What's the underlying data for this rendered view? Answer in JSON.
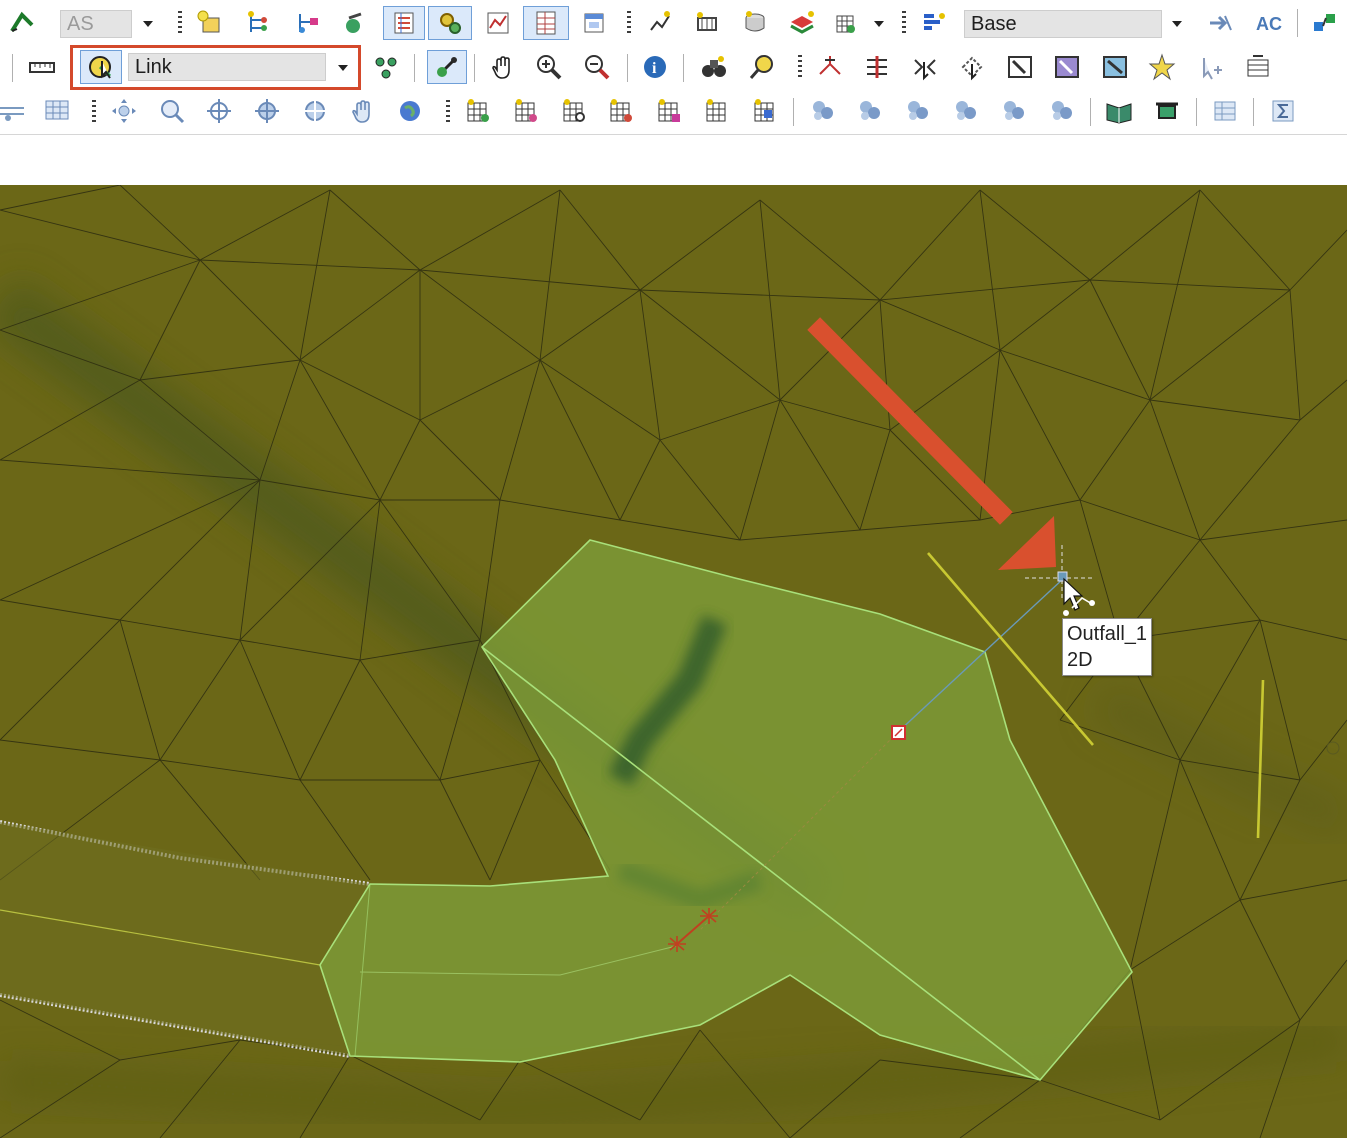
{
  "toolbar1": {
    "scenario_combo": "AS",
    "base_combo": "Base"
  },
  "toolbar2": {
    "link_combo": "Link"
  },
  "map": {
    "tooltip_line1": "Outfall_1",
    "tooltip_line2": "2D"
  },
  "colors": {
    "terrain": "#6b6717",
    "polygon_fill": "#7f9f3a",
    "polygon_edge": "#a8e07a",
    "annotation_arrow": "#d9502e",
    "highlight_box": "#d4492b",
    "yellow_line": "#c8c832"
  }
}
